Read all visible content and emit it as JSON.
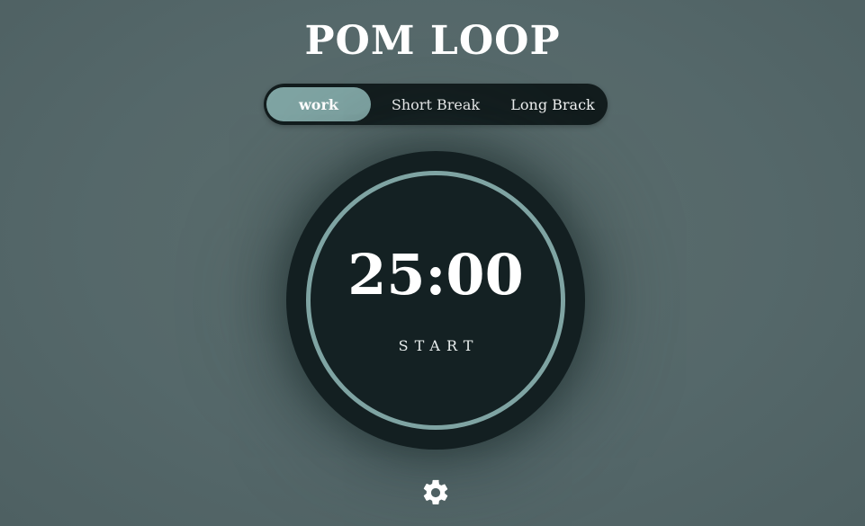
{
  "app": {
    "title": "POM LOOP"
  },
  "modes": {
    "tabs": [
      {
        "label": "work",
        "active": true
      },
      {
        "label": "Short Break",
        "active": false
      },
      {
        "label": "Long Brack",
        "active": false
      }
    ]
  },
  "timer": {
    "time": "25:00",
    "action_label": "START",
    "progress": 1.0
  },
  "settings": {
    "icon": "gear-icon"
  },
  "colors": {
    "background": "#55686a",
    "panel": "#121c1d",
    "accent": "#7fa4a3",
    "text": "#ffffff"
  }
}
